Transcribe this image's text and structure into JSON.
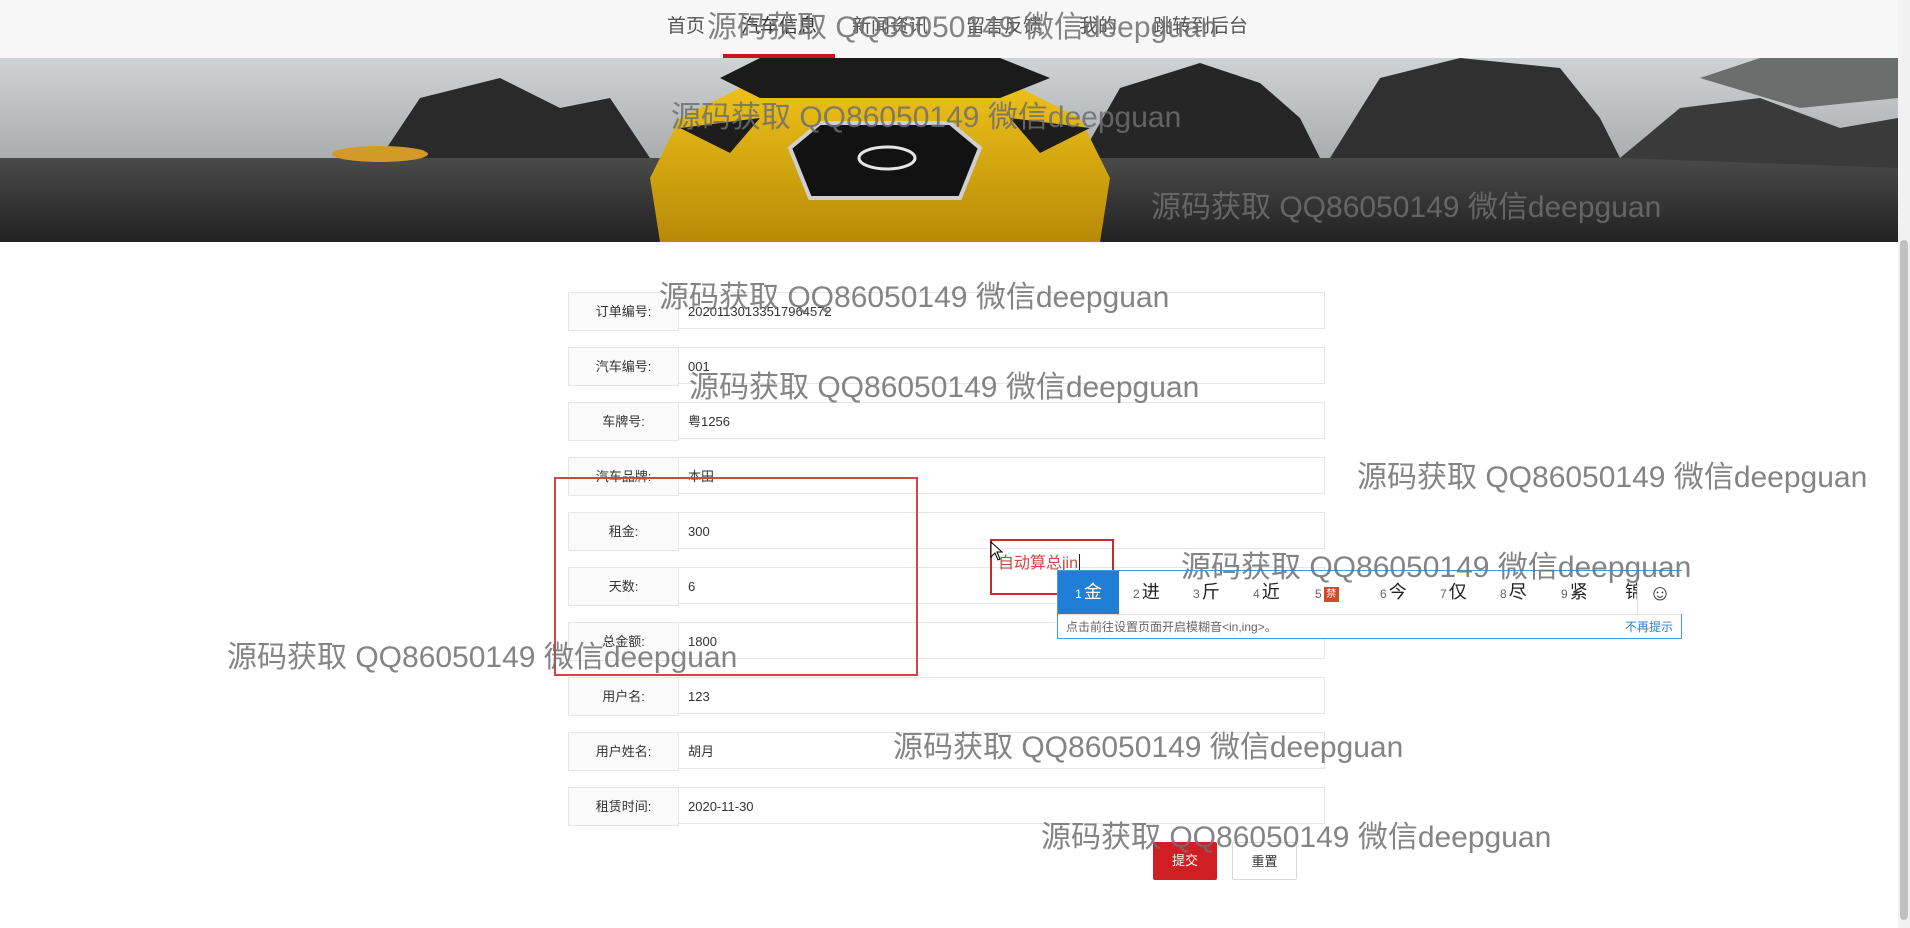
{
  "nav": {
    "items": [
      {
        "label": "首页",
        "active": false
      },
      {
        "label": "汽车信息",
        "active": true
      },
      {
        "label": "新闻资讯",
        "active": false
      },
      {
        "label": "留言反馈",
        "active": false
      },
      {
        "label": "我的",
        "active": false
      },
      {
        "label": "跳转到后台",
        "active": false
      }
    ],
    "accent_color": "#c9151e"
  },
  "banner": {
    "image": "yellow-sports-car-photo"
  },
  "form": {
    "fields": [
      {
        "label": "订单编号:",
        "value": "20201130133517964572"
      },
      {
        "label": "汽车编号:",
        "value": "001"
      },
      {
        "label": "车牌号:",
        "value": "粤1256"
      },
      {
        "label": "汽车品牌:",
        "value": "本田"
      },
      {
        "label": "租金:",
        "value": "300"
      },
      {
        "label": "天数:",
        "value": "6"
      },
      {
        "label": "总金额:",
        "value": "1800"
      },
      {
        "label": "用户名:",
        "value": "123"
      },
      {
        "label": "用户姓名:",
        "value": "胡月"
      },
      {
        "label": "租赁时间:",
        "value": "2020-11-30"
      }
    ],
    "submit_label": "提交",
    "reset_label": "重置",
    "submit_color": "#d01f24"
  },
  "annotation": {
    "text": "自动算总jin",
    "color": "#d44545"
  },
  "ime": {
    "candidates": [
      {
        "num": "1",
        "text": "金"
      },
      {
        "num": "2",
        "text": "进"
      },
      {
        "num": "3",
        "text": "斤"
      },
      {
        "num": "4",
        "text": "近"
      },
      {
        "num": "5",
        "text": "禁"
      },
      {
        "num": "6",
        "text": "今"
      },
      {
        "num": "7",
        "text": "仅"
      },
      {
        "num": "8",
        "text": "尽"
      },
      {
        "num": "9",
        "text": "紧"
      },
      {
        "num": "",
        "text": "锦"
      }
    ],
    "emoji_icon": "☺",
    "tip": "点击前往设置页面开启模糊音<in,ing>。",
    "close_label": "不再提示"
  },
  "watermark": "源码获取 QQ86050149 微信deepguan"
}
